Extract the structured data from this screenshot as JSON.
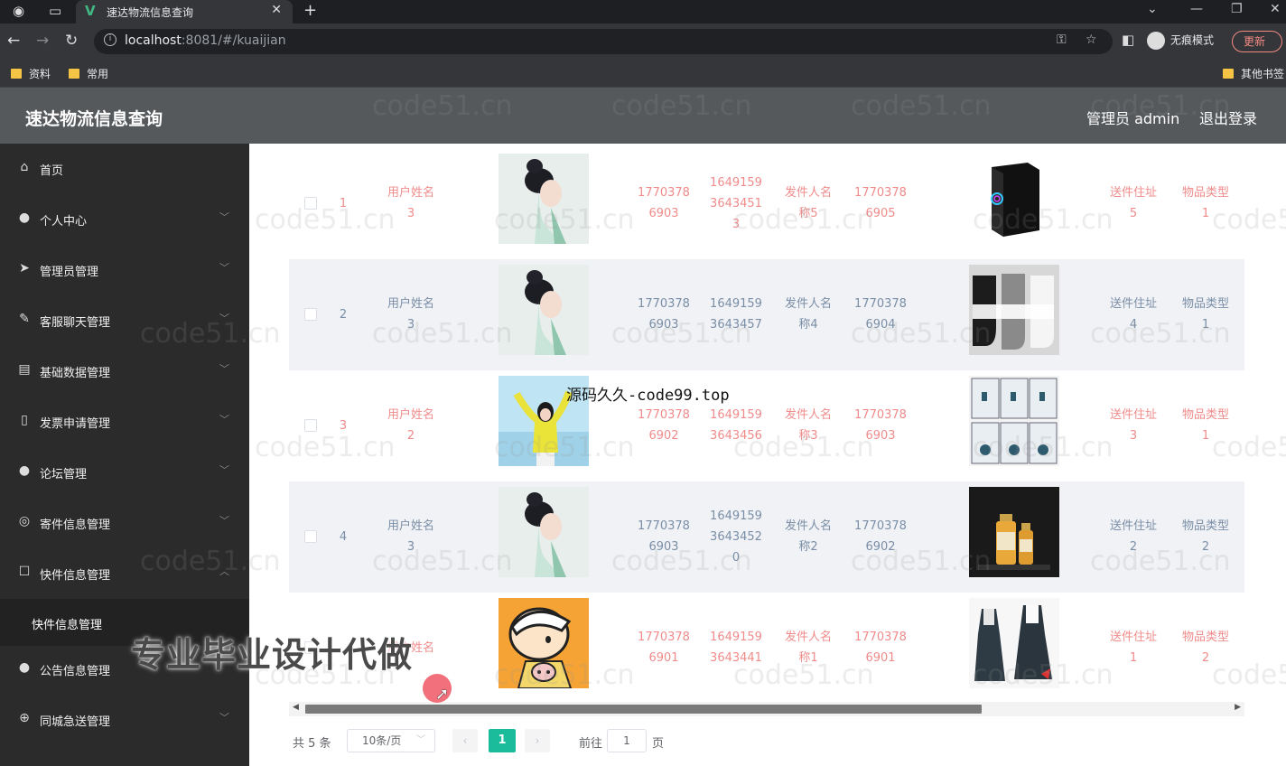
{
  "browser": {
    "tab_title": "速达物流信息查询",
    "url_host": "localhost",
    "url_rest": ":8081/#/kuaijian",
    "incognito_label": "无痕模式",
    "update_label": "更新",
    "bookmarks": [
      "资料",
      "常用"
    ],
    "other_bookmarks": "其他书签"
  },
  "header": {
    "title": "速达物流信息查询",
    "admin": "管理员 admin",
    "logout": "退出登录"
  },
  "sidebar": {
    "items": [
      {
        "label": "首页",
        "icon": "home-icon",
        "arrow": false
      },
      {
        "label": "个人中心",
        "icon": "user-icon",
        "arrow": true
      },
      {
        "label": "管理员管理",
        "icon": "send-icon",
        "arrow": true
      },
      {
        "label": "客服聊天管理",
        "icon": "edit-icon",
        "arrow": true
      },
      {
        "label": "基础数据管理",
        "icon": "data-icon",
        "arrow": true
      },
      {
        "label": "发票申请管理",
        "icon": "phone-icon",
        "arrow": true
      },
      {
        "label": "论坛管理",
        "icon": "user-icon",
        "arrow": true
      },
      {
        "label": "寄件信息管理",
        "icon": "circle-icon",
        "arrow": true
      },
      {
        "label": "快件信息管理",
        "icon": "box-icon",
        "arrow": true,
        "expanded": true
      },
      {
        "label": "公告信息管理",
        "icon": "bulb-icon",
        "arrow": false
      },
      {
        "label": "同城急送管理",
        "icon": "globe-icon",
        "arrow": true
      }
    ],
    "subitem": "快件信息管理"
  },
  "table": {
    "rows": [
      {
        "index": "1",
        "user_l1": "用户姓名",
        "user_l2": "3",
        "phone_l1": "1770378",
        "phone_l2": "6903",
        "code_l1": "1649159",
        "code_l2": "3643451",
        "code_l3": "3",
        "sender_l1": "发件人名",
        "sender_l2": "称5",
        "sphone_l1": "1770378",
        "sphone_l2": "6905",
        "addr_l1": "送件住址",
        "addr_l2": "5",
        "type_l1": "物品类型",
        "type_l2": "1",
        "photo": "woman",
        "item": "pc-case"
      },
      {
        "index": "2",
        "user_l1": "用户姓名",
        "user_l2": "3",
        "phone_l1": "1770378",
        "phone_l2": "6903",
        "code_l1": "1649159",
        "code_l2": "3643457",
        "code_l3": "",
        "sender_l1": "发件人名",
        "sender_l2": "称4",
        "sphone_l1": "1770378",
        "sphone_l2": "6904",
        "addr_l1": "送件住址",
        "addr_l2": "4",
        "type_l1": "物品类型",
        "type_l2": "1",
        "photo": "woman",
        "item": "socks"
      },
      {
        "index": "3",
        "user_l1": "用户姓名",
        "user_l2": "2",
        "phone_l1": "1770378",
        "phone_l2": "6902",
        "code_l1": "1649159",
        "code_l2": "3643456",
        "code_l3": "",
        "sender_l1": "发件人名",
        "sender_l2": "称3",
        "sphone_l1": "1770378",
        "sphone_l2": "6903",
        "addr_l1": "送件住址",
        "addr_l2": "3",
        "type_l1": "物品类型",
        "type_l2": "1",
        "photo": "girl-yellow",
        "item": "shirts"
      },
      {
        "index": "4",
        "user_l1": "用户姓名",
        "user_l2": "3",
        "phone_l1": "1770378",
        "phone_l2": "6903",
        "code_l1": "1649159",
        "code_l2": "3643452",
        "code_l3": "0",
        "sender_l1": "发件人名",
        "sender_l2": "称2",
        "sphone_l1": "1770378",
        "sphone_l2": "6902",
        "addr_l1": "送件住址",
        "addr_l2": "2",
        "type_l1": "物品类型",
        "type_l2": "2",
        "photo": "woman",
        "item": "bottles"
      },
      {
        "index": "",
        "user_l1": "用户姓名",
        "user_l2": "",
        "phone_l1": "1770378",
        "phone_l2": "6901",
        "code_l1": "1649159",
        "code_l2": "3643441",
        "code_l3": "",
        "sender_l1": "发件人名",
        "sender_l2": "称1",
        "sphone_l1": "1770378",
        "sphone_l2": "6901",
        "addr_l1": "送件住址",
        "addr_l2": "1",
        "type_l1": "物品类型",
        "type_l2": "2",
        "photo": "cartoon",
        "item": "dress"
      }
    ]
  },
  "pagination": {
    "total": "共 5 条",
    "page_size": "10条/页",
    "current": "1",
    "goto_label": "前往",
    "goto_value": "1",
    "page_unit": "页"
  },
  "overlays": {
    "code99": "源码久久-code99.top",
    "promo": "专业毕业设计代做",
    "watermark": "code51.cn"
  },
  "colors": {
    "accent": "#1bbc9b",
    "odd_row_text": "#f08b8b",
    "even_row_text": "#7a8ea7",
    "sidebar_bg": "#2b2b2b",
    "header_bg": "#56595c"
  }
}
